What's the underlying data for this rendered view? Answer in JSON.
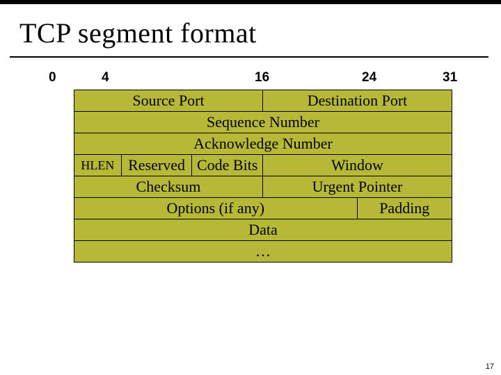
{
  "title": "TCP segment format",
  "bit_labels": {
    "b0": "0",
    "b4": "4",
    "b16": "16",
    "b24": "24",
    "b31": "31"
  },
  "rows": {
    "r1": {
      "source_port": "Source Port",
      "dest_port": "Destination Port"
    },
    "r2": {
      "sequence": "Sequence Number"
    },
    "r3": {
      "ack": "Acknowledge Number"
    },
    "r4": {
      "hlen": "HLEN",
      "reserved": "Reserved",
      "code_bits": "Code Bits",
      "window": "Window"
    },
    "r5": {
      "checksum": "Checksum",
      "urgent": "Urgent Pointer"
    },
    "r6": {
      "options": "Options (if any)",
      "padding": "Padding"
    },
    "r7": {
      "data": "Data"
    },
    "r8": {
      "ellipsis": "…"
    }
  },
  "page_number": "17"
}
